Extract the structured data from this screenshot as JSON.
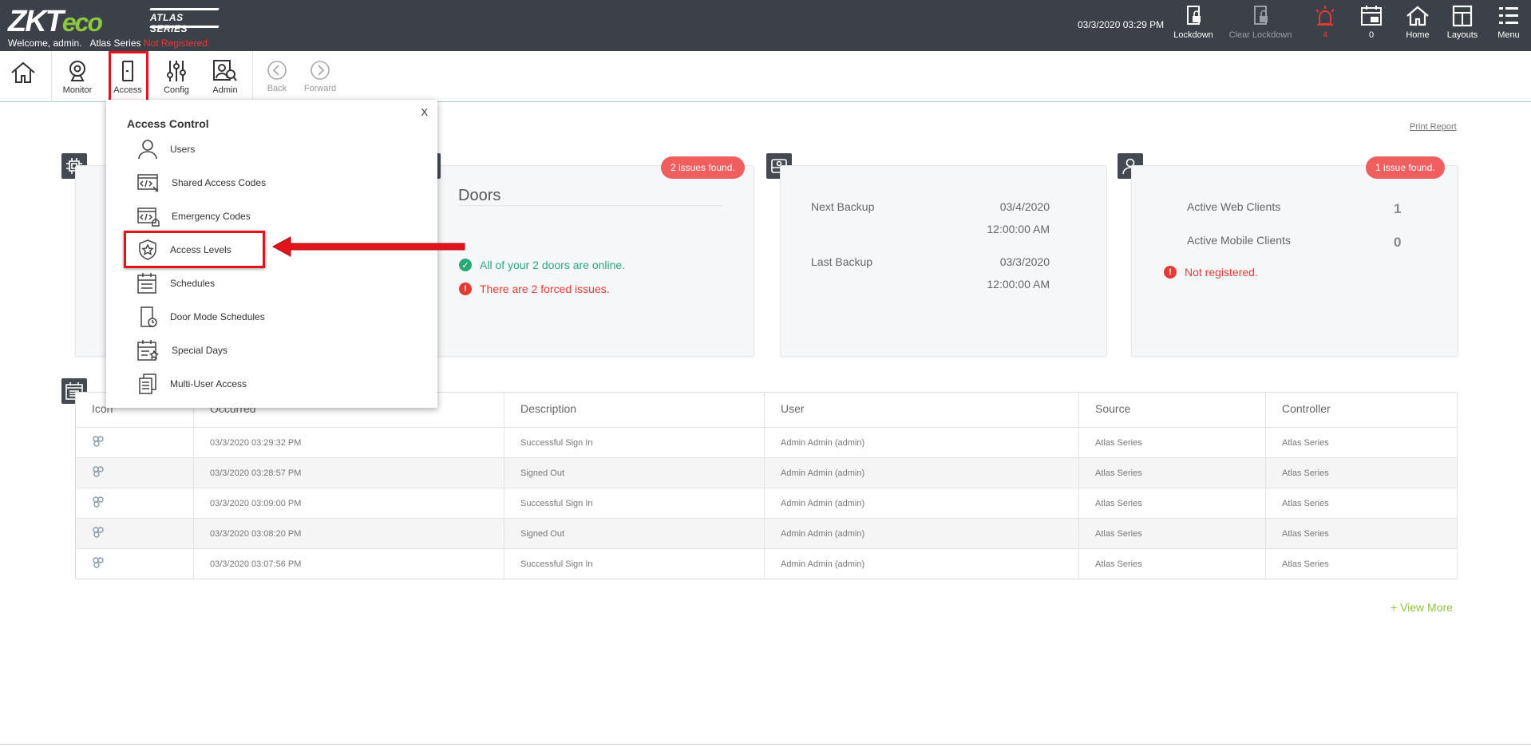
{
  "brand": {
    "logo_main": "ZKT",
    "logo_eco": "eco",
    "series": "ATLAS SERIES"
  },
  "header": {
    "welcome": "Welcome, admin.",
    "site": "Atlas Series",
    "registration": "Not Registered",
    "datetime": "03/3/2020 03:29 PM",
    "buttons": {
      "lockdown": "Lockdown",
      "clear_lockdown": "Clear Lockdown",
      "alarms_count": "4",
      "events_count": "0",
      "home": "Home",
      "layouts": "Layouts",
      "menu": "Menu"
    }
  },
  "toolbar": {
    "monitor": "Monitor",
    "access": "Access",
    "config": "Config",
    "admin": "Admin",
    "back": "Back",
    "forward": "Forward"
  },
  "print_report": "Print Report",
  "doors": {
    "title": "Doors",
    "issues": "2 issues found.",
    "online": "All of your 2 doors are online.",
    "forced": "There are 2 forced issues."
  },
  "backup": {
    "next_label": "Next Backup",
    "next_date": "03/4/2020",
    "next_time": "12:00:00 AM",
    "last_label": "Last Backup",
    "last_date": "03/3/2020",
    "last_time": "12:00:00 AM"
  },
  "clients": {
    "issues": "1 issue found.",
    "web_label": "Active Web Clients",
    "web_count": "1",
    "mobile_label": "Active Mobile Clients",
    "mobile_count": "0",
    "registration": "Not registered."
  },
  "events": {
    "columns": [
      "Icon",
      "Occurred",
      "Description",
      "User",
      "Source",
      "Controller"
    ],
    "rows": [
      {
        "occurred": "03/3/2020 03:29:32 PM",
        "description": "Successful Sign In",
        "user": "Admin Admin (admin)",
        "source": "Atlas Series",
        "controller": "Atlas Series"
      },
      {
        "occurred": "03/3/2020 03:28:57 PM",
        "description": "Signed Out",
        "user": "Admin Admin (admin)",
        "source": "Atlas Series",
        "controller": "Atlas Series"
      },
      {
        "occurred": "03/3/2020 03:09:00 PM",
        "description": "Successful Sign In",
        "user": "Admin Admin (admin)",
        "source": "Atlas Series",
        "controller": "Atlas Series"
      },
      {
        "occurred": "03/3/2020 03:08:20 PM",
        "description": "Signed Out",
        "user": "Admin Admin (admin)",
        "source": "Atlas Series",
        "controller": "Atlas Series"
      },
      {
        "occurred": "03/3/2020 03:07:56 PM",
        "description": "Successful Sign In",
        "user": "Admin Admin (admin)",
        "source": "Atlas Series",
        "controller": "Atlas Series"
      }
    ],
    "view_more": "+ View More"
  },
  "access_menu": {
    "title": "Access Control",
    "close": "X",
    "items": [
      {
        "label": "Users",
        "icon": "user-icon"
      },
      {
        "label": "Shared Access Codes",
        "icon": "shared-codes-icon"
      },
      {
        "label": "Emergency Codes",
        "icon": "emergency-codes-icon"
      },
      {
        "label": "Access Levels",
        "icon": "shield-star-icon"
      },
      {
        "label": "Schedules",
        "icon": "calendar-icon"
      },
      {
        "label": "Door Mode Schedules",
        "icon": "door-clock-icon"
      },
      {
        "label": "Special Days",
        "icon": "calendar-star-icon"
      },
      {
        "label": "Multi-User Access",
        "icon": "documents-icon"
      }
    ]
  },
  "colors": {
    "topbar": "#3c4049",
    "accent_green": "#8dc63f",
    "alert_red": "#e53935",
    "highlight_red": "#e0141b"
  }
}
